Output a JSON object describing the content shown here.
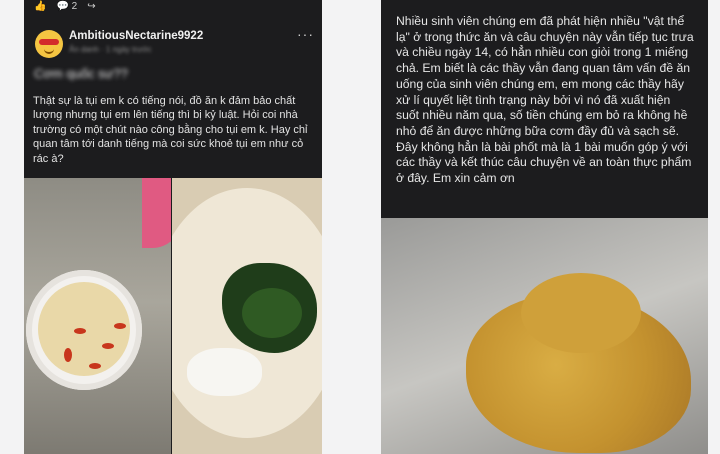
{
  "left_post": {
    "top_icons": [
      "👍",
      "💬 2",
      "↪"
    ],
    "username": "AmbitiousNectarine9922",
    "meta": "Ẩn danh · 1 ngày trước",
    "more_label": "···",
    "title": "Cơm quốc sư??",
    "body": "Thật sự là tụi em k có tiếng nói, đồ ăn k đảm bảo chất lượng nhưng tụi em lên tiếng thì bị kỷ luật. Hỏi coi nhà trường có một chút nào công bằng cho tụi em k. Hay chỉ quan tâm tới danh tiếng mà coi sức khoẻ tụi em như cỏ rác à?"
  },
  "right_post": {
    "body": "Nhiều sinh viên chúng em đã phát hiện nhiều \"vật thể lạ\" ở trong thức ăn và câu chuyện này vẫn tiếp tục trưa và chiều ngày 14, có hẳn nhiều con giòi trong 1 miếng chả. Em biết là các thầy vẫn đang quan tâm vấn đề ăn uống của sinh viên chúng em, em mong các thầy hãy xử lí quyết liệt tình trạng này bởi vì nó đã xuất hiện suốt nhiều năm qua, số tiền chúng em bỏ ra không hề nhỏ để ăn được những bữa cơm đầy đủ và sạch sẽ. Đây không hẳn là bài phốt mà là 1 bài muốn góp ý với các thầy và kết thúc câu chuyện về an toàn thực phẩm ở đây. Em xin cảm ơn"
  },
  "colors": {
    "panel_bg": "#1c1c1e",
    "page_bg": "#f3f3f4",
    "text": "#e6e6e6"
  }
}
